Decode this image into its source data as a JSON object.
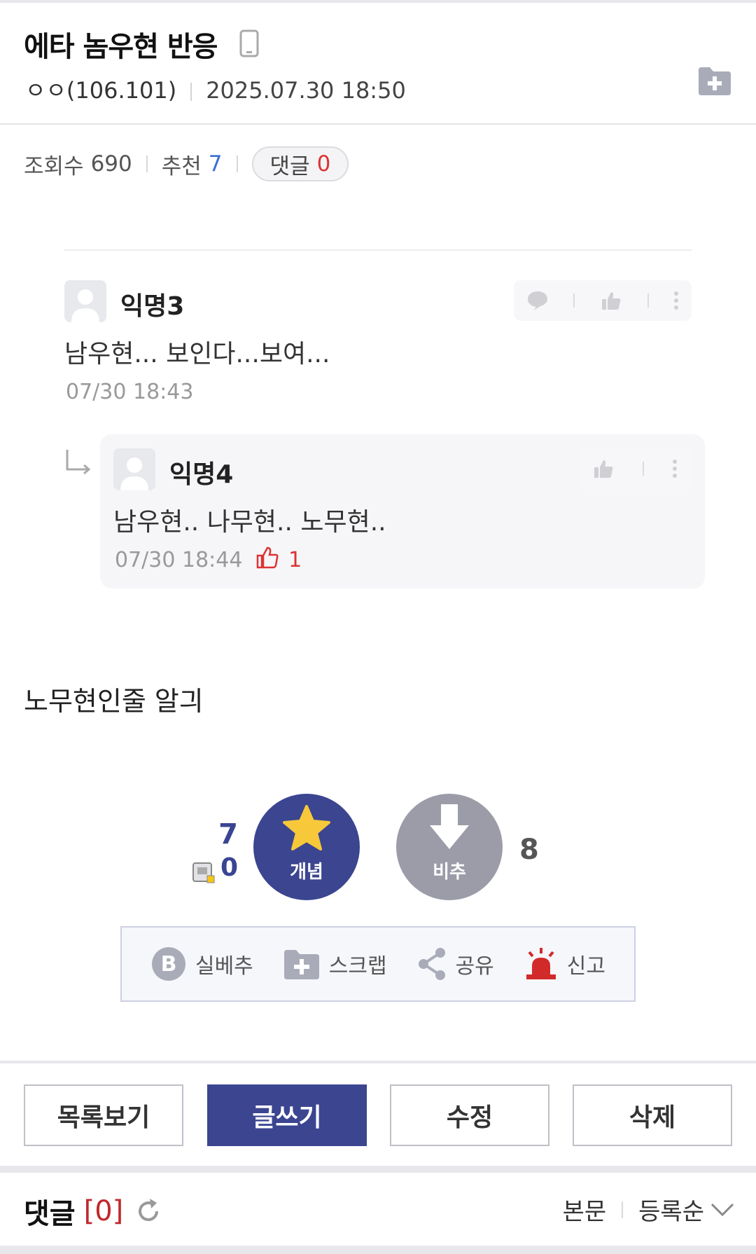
{
  "post": {
    "title": "에타 놈우현 반응",
    "author": "ㅇㅇ(106.101)",
    "date": "2025.07.30 18:50",
    "views_label": "조회수",
    "views": "690",
    "recommend_label": "추천",
    "recommend": "7",
    "comments_label": "댓글",
    "comments": "0",
    "body": "노무현인줄 알긔"
  },
  "embedded_comments": [
    {
      "name": "익명3",
      "text": "남우현... 보인다...보여...",
      "time": "07/30 18:43"
    },
    {
      "name": "익명4",
      "text": "남우현.. 나무현.. 노무현..",
      "time": "07/30 18:44",
      "likes": "1"
    }
  ],
  "vote": {
    "up_label": "개념",
    "up_count": "7",
    "fix_count": "0",
    "down_label": "비추",
    "down_count": "8"
  },
  "tools": {
    "best": "실베추",
    "scrap": "스크랩",
    "share": "공유",
    "report": "신고"
  },
  "buttons": {
    "list": "목록보기",
    "write": "글쓰기",
    "edit": "수정",
    "delete": "삭제"
  },
  "comment_section": {
    "title": "댓글",
    "count": "[0]",
    "filter": "본문",
    "sort": "등록순"
  },
  "colors": {
    "accent": "#3b4590",
    "recommend_blue": "#3b6fd6",
    "red": "#c0282d"
  }
}
